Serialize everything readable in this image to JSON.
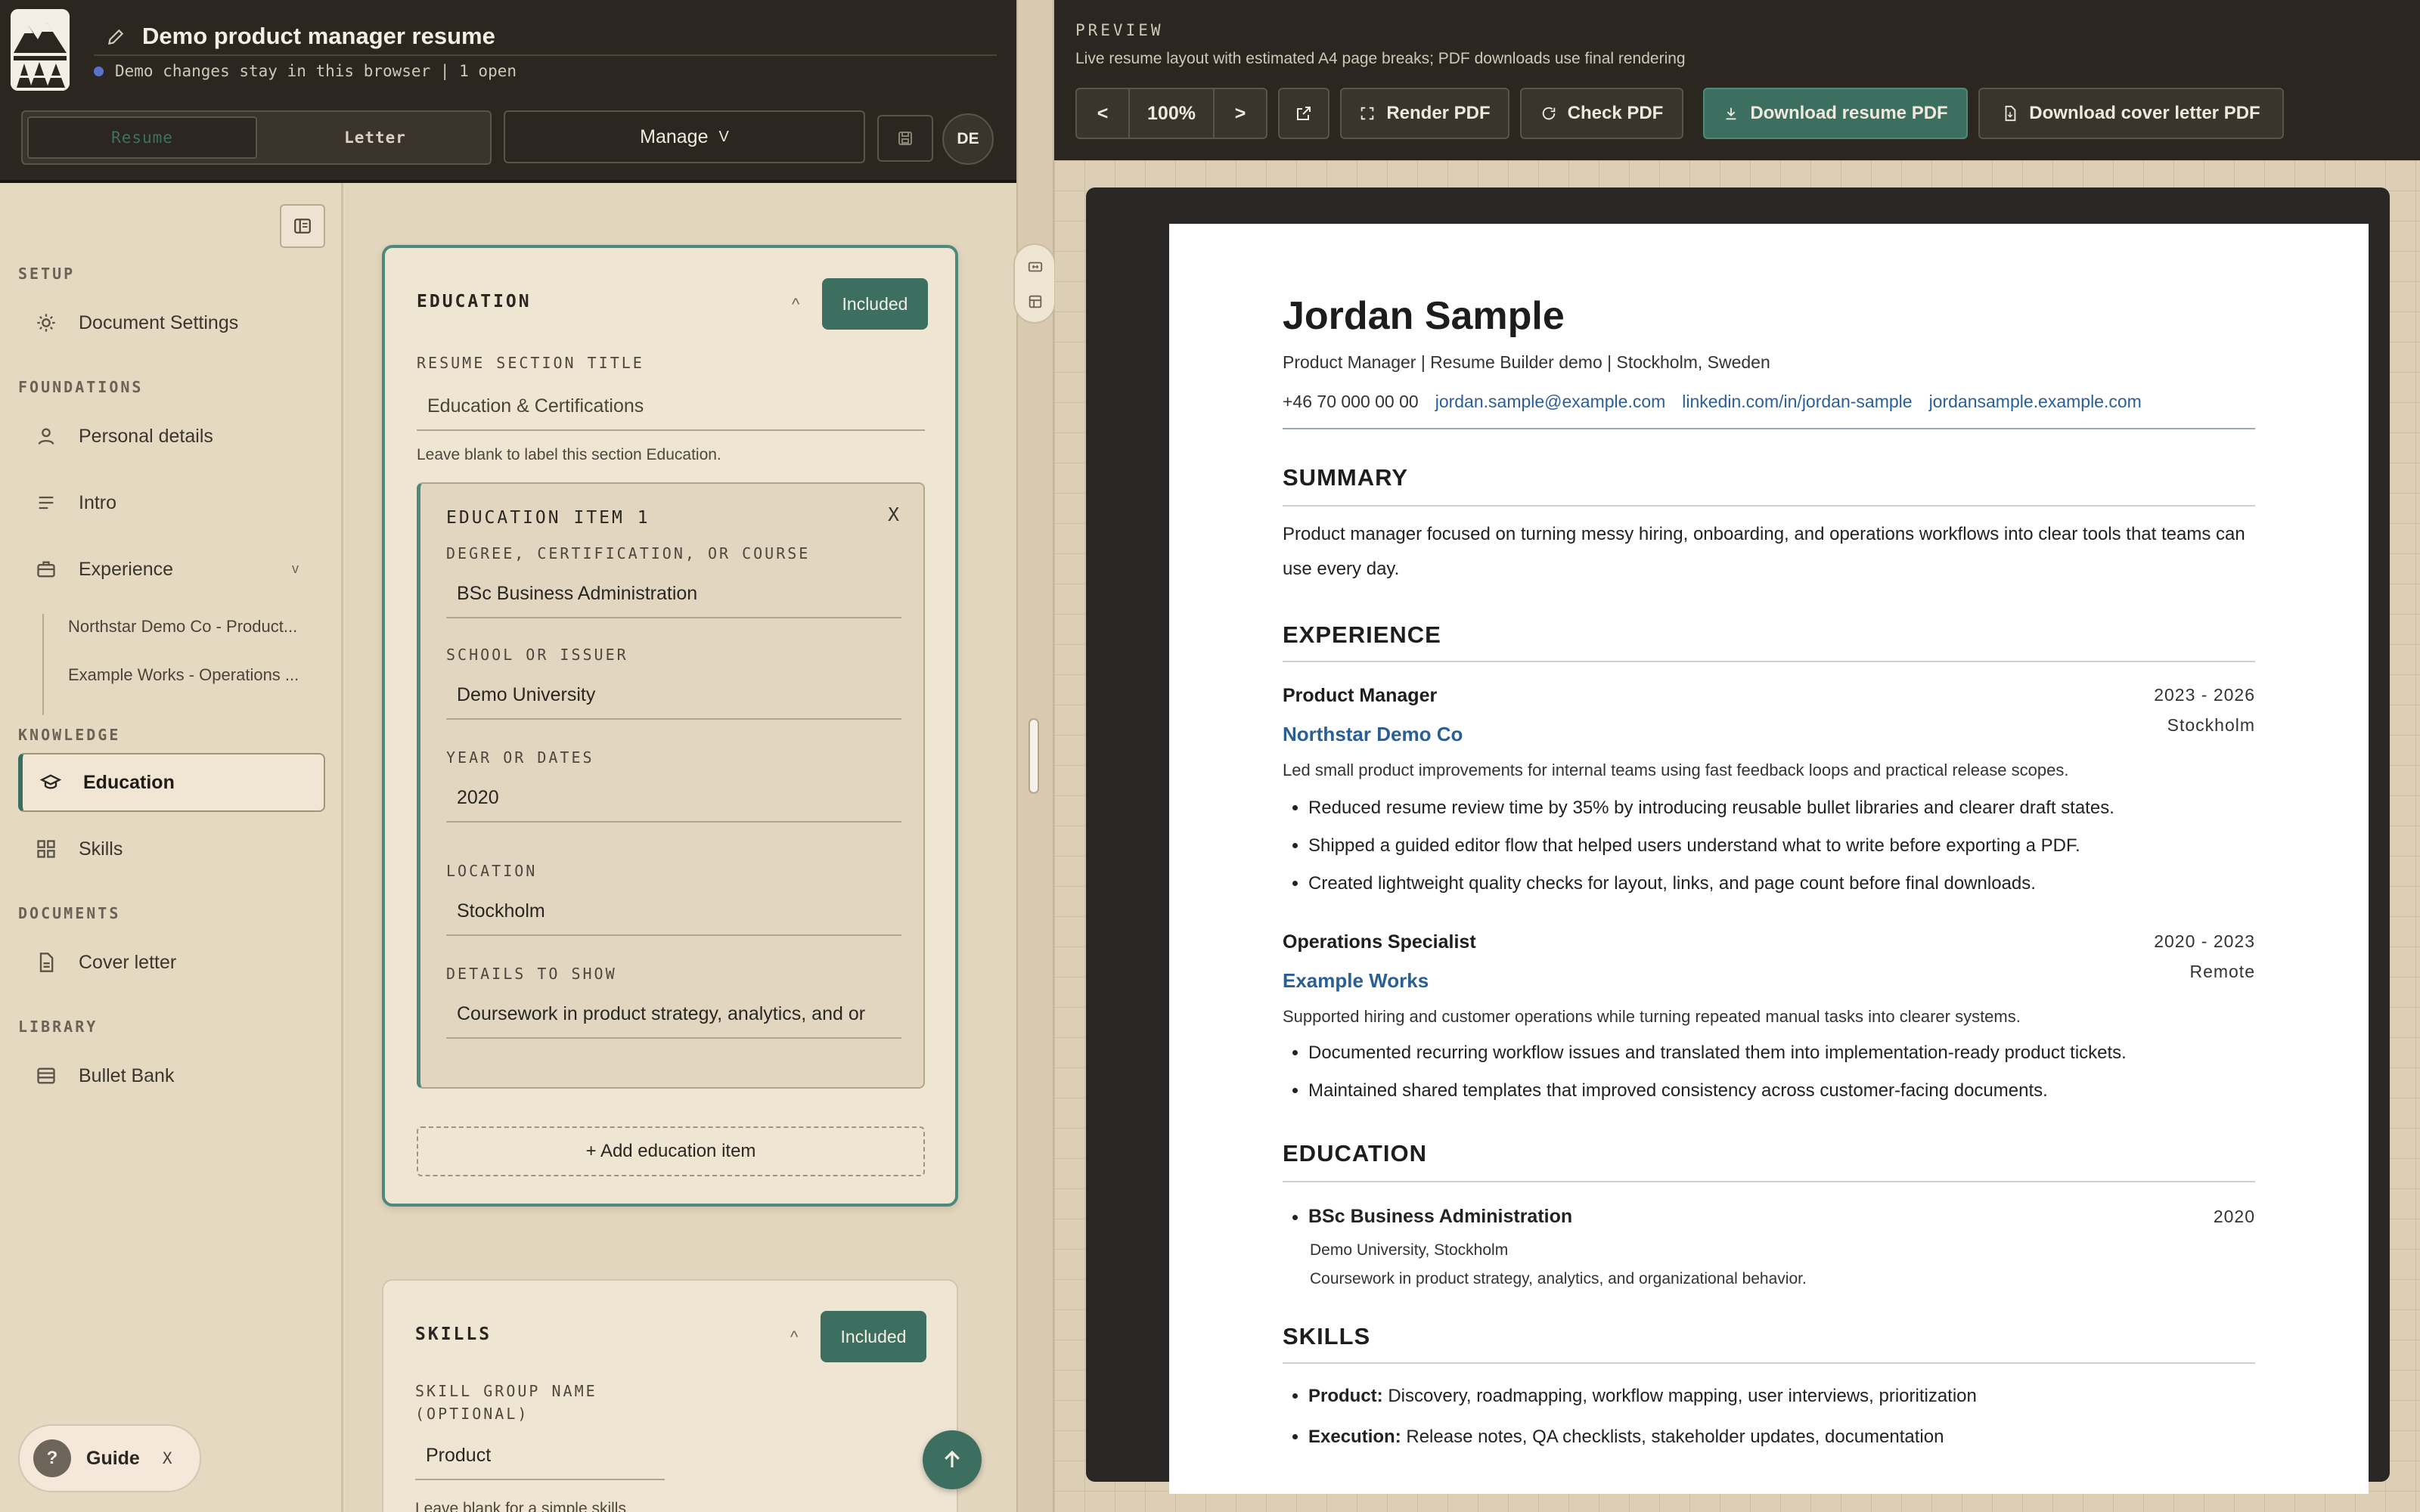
{
  "header": {
    "doc_title": "Demo product manager resume",
    "status": "Demo changes stay in this browser | 1 open",
    "tab_resume": "Resume",
    "tab_letter": "Letter",
    "manage": "Manage",
    "manage_chevron": "V",
    "avatar": "DE"
  },
  "sidebar": {
    "setup": "SETUP",
    "document_settings": "Document Settings",
    "foundations": "FOUNDATIONS",
    "personal_details": "Personal details",
    "intro": "Intro",
    "experience": "Experience",
    "experience_chevron": "v",
    "exp_sub_1": "Northstar Demo Co - Product...",
    "exp_sub_2": "Example Works - Operations ...",
    "knowledge": "KNOWLEDGE",
    "education": "Education",
    "skills": "Skills",
    "documents": "DOCUMENTS",
    "cover_letter": "Cover letter",
    "library": "LIBRARY",
    "bullet_bank": "Bullet Bank"
  },
  "editor": {
    "edu_title": "EDUCATION",
    "caret": "^",
    "included": "Included",
    "section_title_label": "RESUME SECTION TITLE",
    "section_title_placeholder": "Education & Certifications",
    "section_title_hint": "Leave blank to label this section Education.",
    "item_title": "EDUCATION ITEM 1",
    "item_remove": "X",
    "degree_label": "DEGREE, CERTIFICATION, OR COURSE",
    "degree_value": "BSc Business Administration",
    "school_label": "SCHOOL OR ISSUER",
    "school_value": "Demo University",
    "year_label": "YEAR OR DATES",
    "year_value": "2020",
    "location_label": "LOCATION",
    "location_value": "Stockholm",
    "details_label": "DETAILS TO SHOW",
    "details_value": "Coursework in product strategy, analytics, and or",
    "add_edu": "+ Add education item",
    "skills_title": "SKILLS",
    "skill_group_label_1": "SKILL GROUP NAME",
    "skill_group_label_2": "(OPTIONAL)",
    "skill_group_value": "Product",
    "skill_hint": "Leave blank for a simple skills"
  },
  "guide": {
    "q": "?",
    "label": "Guide",
    "close": "X"
  },
  "preview": {
    "label": "PREVIEW",
    "desc": "Live resume layout with estimated A4 page breaks; PDF downloads use final rendering",
    "prev": "<",
    "zoom": "100%",
    "next": ">",
    "render": "Render PDF",
    "check": "Check PDF",
    "download_resume": "Download resume PDF",
    "download_letter": "Download cover letter PDF"
  },
  "resume": {
    "name": "Jordan Sample",
    "headline": "Product Manager | Resume Builder demo | Stockholm, Sweden",
    "phone": "+46 70 000 00 00",
    "email": "jordan.sample@example.com",
    "linkedin": "linkedin.com/in/jordan-sample",
    "website": "jordansample.example.com",
    "summary_title": "SUMMARY",
    "summary": "Product manager focused on turning messy hiring, onboarding, and operations workflows into clear tools that teams can use every day.",
    "experience_title": "EXPERIENCE",
    "jobs": [
      {
        "role": "Product Manager",
        "dates": "2023 - 2026",
        "company": "Northstar Demo Co",
        "location": "Stockholm",
        "summary": "Led small product improvements for internal teams using fast feedback loops and practical release scopes.",
        "bullets": [
          "Reduced resume review time by 35% by introducing reusable bullet libraries and clearer draft states.",
          "Shipped a guided editor flow that helped users understand what to write before exporting a PDF.",
          "Created lightweight quality checks for layout, links, and page count before final downloads."
        ]
      },
      {
        "role": "Operations Specialist",
        "dates": "2020 - 2023",
        "company": "Example Works",
        "location": "Remote",
        "summary": "Supported hiring and customer operations while turning repeated manual tasks into clearer systems.",
        "bullets": [
          "Documented recurring workflow issues and translated them into implementation-ready product tickets.",
          "Maintained shared templates that improved consistency across customer-facing documents."
        ]
      }
    ],
    "education_title": "EDUCATION",
    "edu_degree": "BSc Business Administration",
    "edu_year": "2020",
    "edu_school": "Demo University, Stockholm",
    "edu_details": "Coursework in product strategy, analytics, and organizational behavior.",
    "skills_title": "SKILLS",
    "skill_1_label": "Product:",
    "skill_1_text": "Discovery, roadmapping, workflow mapping, user interviews, prioritization",
    "skill_2_label": "Execution:",
    "skill_2_text": "Release notes, QA checklists, stakeholder updates, documentation"
  },
  "colors": {
    "accent": "#3d6f61",
    "header_bg": "#2b2720",
    "link": "#2a5f96"
  }
}
